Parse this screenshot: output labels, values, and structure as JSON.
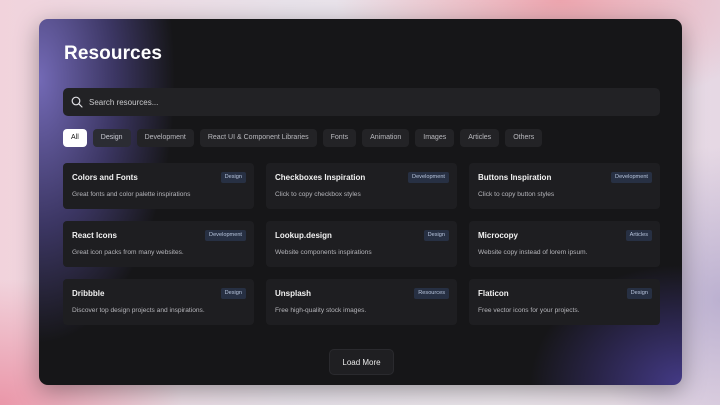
{
  "page": {
    "title": "Resources"
  },
  "search": {
    "placeholder": "Search resources...",
    "value": "",
    "icon": "search-icon"
  },
  "filters": [
    {
      "label": "All",
      "active": true
    },
    {
      "label": "Design",
      "active": false
    },
    {
      "label": "Development",
      "active": false
    },
    {
      "label": "React UI & Component Libraries",
      "active": false
    },
    {
      "label": "Fonts",
      "active": false
    },
    {
      "label": "Animation",
      "active": false
    },
    {
      "label": "Images",
      "active": false
    },
    {
      "label": "Articles",
      "active": false
    },
    {
      "label": "Others",
      "active": false
    }
  ],
  "cards": [
    {
      "title": "Colors and Fonts",
      "description": "Great fonts and color palette inspirations",
      "tag": "Design"
    },
    {
      "title": "Checkboxes Inspiration",
      "description": "Click to copy checkbox styles",
      "tag": "Development"
    },
    {
      "title": "Buttons Inspiration",
      "description": "Click to copy button styles",
      "tag": "Development"
    },
    {
      "title": "React Icons",
      "description": "Great icon packs from many websites.",
      "tag": "Development"
    },
    {
      "title": "Lookup.design",
      "description": "Website components inspirations",
      "tag": "Design"
    },
    {
      "title": "Microcopy",
      "description": "Website copy instead of lorem ipsum.",
      "tag": "Articles"
    },
    {
      "title": "Dribbble",
      "description": "Discover top design projects and inspirations.",
      "tag": "Design"
    },
    {
      "title": "Unsplash",
      "description": "Free high-quality stock images.",
      "tag": "Resources"
    },
    {
      "title": "Flaticon",
      "description": "Free vector icons for your projects.",
      "tag": "Design"
    }
  ],
  "load_more": {
    "label": "Load More"
  },
  "colors": {
    "panel_background": "#161618",
    "card_background": "#1e1e21",
    "badge_background": "#273043",
    "active_chip": "#ffffff",
    "accent_purple": "#6b62b8"
  }
}
